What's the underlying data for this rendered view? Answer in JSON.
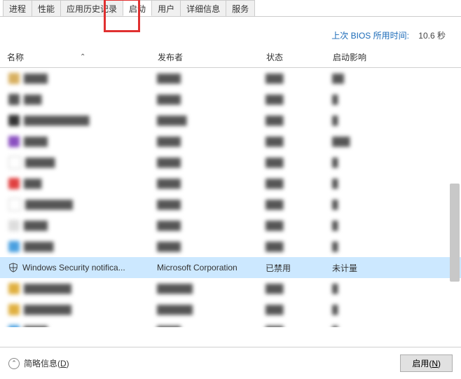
{
  "tabs": {
    "t0": "进程",
    "t1": "性能",
    "t2": "应用历史记录",
    "t3": "启动",
    "t4": "用户",
    "t5": "详细信息",
    "t6": "服务"
  },
  "bios": {
    "label": "上次 BIOS 所用时间:",
    "value": "10.6 秒"
  },
  "cols": {
    "name": "名称",
    "pub": "发布者",
    "status": "状态",
    "impact": "启动影响"
  },
  "selected": {
    "name": "Windows Security notifica...",
    "pub": "Microsoft Corporation",
    "status": "已禁用",
    "impact": "未计量"
  },
  "footer": {
    "brief": "简略信息(",
    "brief_k": "D",
    "brief_end": ")",
    "enable": "启用(",
    "enable_k": "N",
    "enable_end": ")"
  }
}
